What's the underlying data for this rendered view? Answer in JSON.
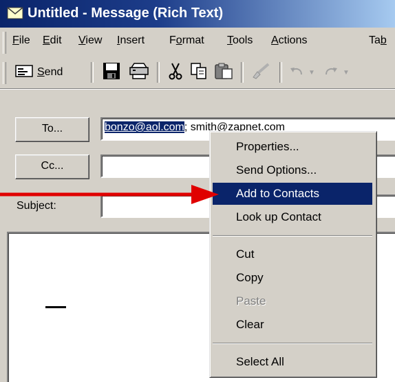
{
  "window": {
    "title": "Untitled - Message (Rich Text)"
  },
  "menubar": {
    "items": [
      {
        "pre": "",
        "u": "F",
        "post": "ile"
      },
      {
        "pre": "",
        "u": "E",
        "post": "dit"
      },
      {
        "pre": "",
        "u": "V",
        "post": "iew"
      },
      {
        "pre": "",
        "u": "I",
        "post": "nsert"
      },
      {
        "pre": "F",
        "u": "o",
        "post": "rmat"
      },
      {
        "pre": "",
        "u": "T",
        "post": "ools"
      },
      {
        "pre": "",
        "u": "A",
        "post": "ctions"
      },
      {
        "pre": "Ta",
        "u": "b",
        "post": ""
      }
    ]
  },
  "toolbar": {
    "send_pre": "",
    "send_u": "S",
    "send_post": "end"
  },
  "form": {
    "to_button": "To...",
    "cc_button": "Cc...",
    "subject_label": "Subject:",
    "to_selected": "bonzo@aol.com",
    "to_rest": "; smith@zapnet.com",
    "cc_value": "",
    "subject_value": ""
  },
  "context_menu": {
    "properties": "Properties...",
    "send_options": "Send Options...",
    "add_to_contacts": "Add to Contacts",
    "look_up_contact": "Look up Contact",
    "cut": "Cut",
    "copy": "Copy",
    "paste": "Paste",
    "clear": "Clear",
    "select_all": "Select All"
  },
  "colors": {
    "selection": "#0a246a",
    "arrow": "#e00000",
    "face": "#d4d0c8"
  }
}
